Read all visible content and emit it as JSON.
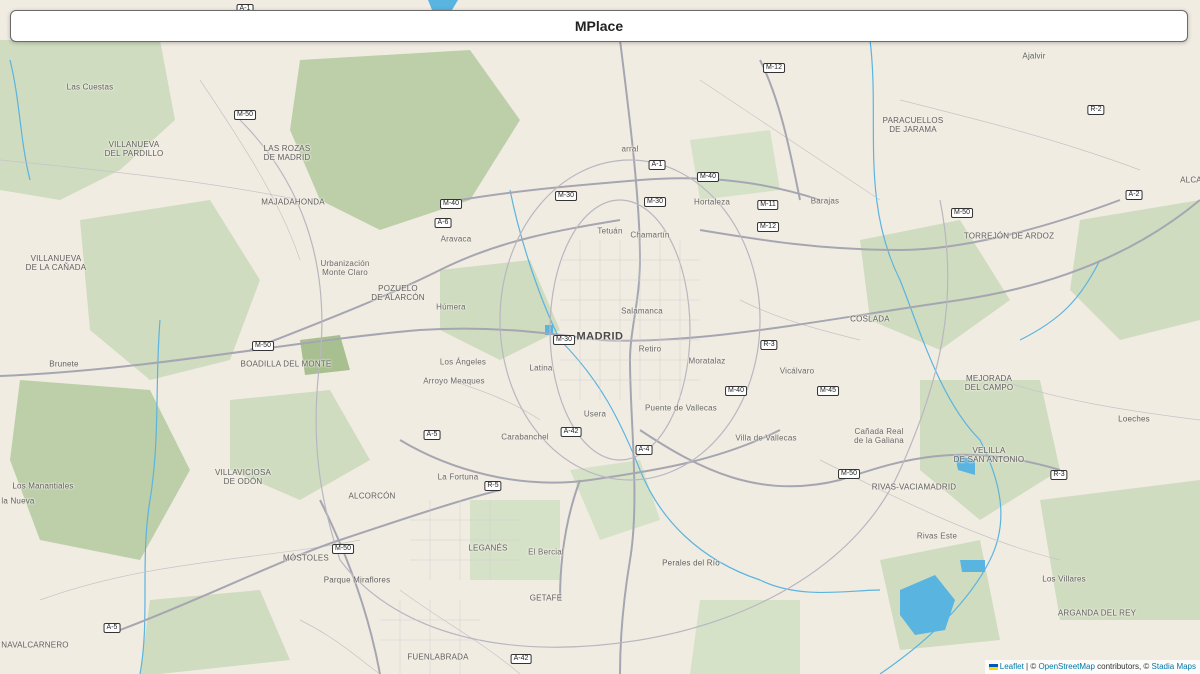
{
  "header": {
    "title": "MPlace"
  },
  "map": {
    "colors": {
      "land": "#f1ece2",
      "green": "#cfdcbf",
      "dark_green": "#b7cba4",
      "road": "#b5b5bf",
      "road_major": "#a6a6b2",
      "water": "#5ab4e0"
    },
    "city": "MADRID",
    "places": {
      "las_cuestas": "Las Cuestas",
      "villanueva_del_pardillo": "VILLANUEVA\nDEL PARDILLO",
      "las_rozas": "LAS ROZAS\nDE MADRID",
      "majadahonda": "MAJADAHONDA",
      "villanueva_de_la_canada": "VILLANUEVA\nDE LA CAÑADA",
      "urbanizacion": "Urbanización\nMonte Claro",
      "aravaca": "Aravaca",
      "pozuelo": "POZUELO\nDE ALARCÓN",
      "humera": "Húmera",
      "boadilla": "BOADILLA DEL MONTE",
      "brunete": "Brunete",
      "los_angeles": "Los Ángeles",
      "arroyo_meaques": "Arroyo Meaques",
      "latina": "Latina",
      "carabanchel": "Carabanchel",
      "usera": "Usera",
      "villaviciosa": "VILLAVICIOSA\nDE ODÓN",
      "la_fortuna": "La Fortuna",
      "alcorcon": "ALCORCÓN",
      "los_manantiales": "Los Manantiales",
      "la_nueva": "la Nueva",
      "mostoles": "MÓSTOLES",
      "parque_miraflores": "Parque Miraflores",
      "leganes": "LEGANÉS",
      "el_bercial": "El Bercial",
      "getafe": "GETAFE",
      "navalcarnero": "NAVALCARNERO",
      "fuenlabrada": "FUENLABRADA",
      "perales": "Perales del Río",
      "tetuan": "Tetuán",
      "chamartin": "Chamartín",
      "hortaleza": "Hortaleza",
      "barajas": "Barajas",
      "salamanca": "Salamanca",
      "retiro": "Retiro",
      "moratalaz": "Moratalaz",
      "vicalvaro": "Vicálvaro",
      "puente_vallecas": "Puente de Vallecas",
      "villa_vallecas": "Villa de Vallecas",
      "canada_real": "Cañada Real\nde la Galiana",
      "coslada": "COSLADA",
      "paracuellos": "PARACUELLOS\nDE JARAMA",
      "torrejon": "TORREJÓN DE ARDOZ",
      "ajalvir": "Ajalvir",
      "mejorada": "MEJORADA\nDEL CAMPO",
      "loeches": "Loeches",
      "velilla": "VELILLA\nDE SAN ANTONIO",
      "rivas": "RIVAS-VACIAMADRID",
      "rivas_este": "Rivas Este",
      "los_villares": "Los Villares",
      "arganda": "ARGANDA DEL REY",
      "parral": "arral",
      "alca": "ALCA"
    },
    "road_shields": {
      "a1": "A-1",
      "a1_top": "A-1",
      "m12_top": "M-12",
      "m50_nw": "M-50",
      "m40_n": "M-40",
      "m30_nw": "M-30",
      "m30_n": "M-30",
      "m40_w": "M-40",
      "a6": "A-6",
      "m11": "M-11",
      "m12": "M-12",
      "r2": "R-2",
      "a2": "A-2",
      "m50_e": "M-50",
      "m30_w": "M-30",
      "r3_c": "R-3",
      "m50_w": "M-50",
      "m40_se": "M-40",
      "m45": "M-45",
      "a5_c": "A-5",
      "a42_c": "A-42",
      "a4": "A-4",
      "r5": "R-5",
      "m50_se": "M-50",
      "r3_e": "R-3",
      "m50_sw": "M-50",
      "a5_w": "A-5",
      "a42_s": "A-42"
    }
  },
  "attribution": {
    "leaflet": "Leaflet",
    "sep": " | © ",
    "osm": "OpenStreetMap",
    "contrib": " contributors, © ",
    "stadia": "Stadia Maps"
  }
}
